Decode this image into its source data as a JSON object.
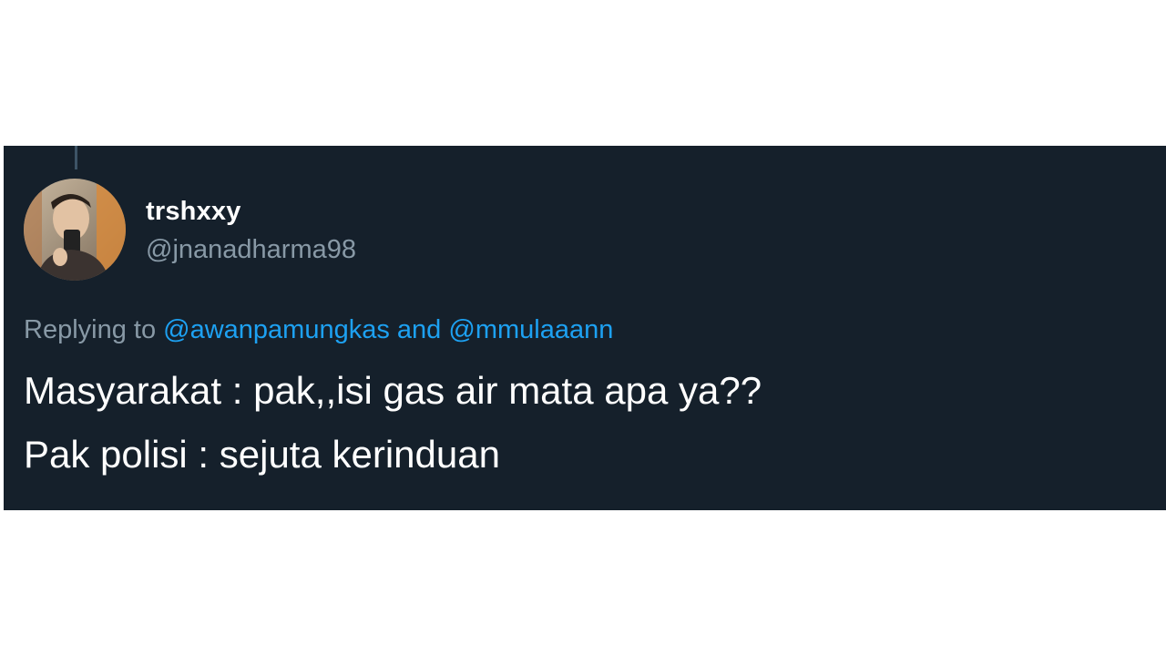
{
  "tweet": {
    "author": {
      "display_name": "trshxxy",
      "handle": "@jnanadharma98"
    },
    "reply": {
      "prefix": "Replying to",
      "mentions": [
        "@awanpamungkas",
        "@mmulaaann"
      ],
      "conjunction": "and"
    },
    "text_lines": [
      "Masyarakat : pak,,isi gas air mata apa ya??",
      "Pak polisi : sejuta kerinduan"
    ]
  },
  "colors": {
    "card_background": "#15202b",
    "text_primary": "#ffffff",
    "text_secondary": "#8899a6",
    "link": "#1da1f2"
  }
}
